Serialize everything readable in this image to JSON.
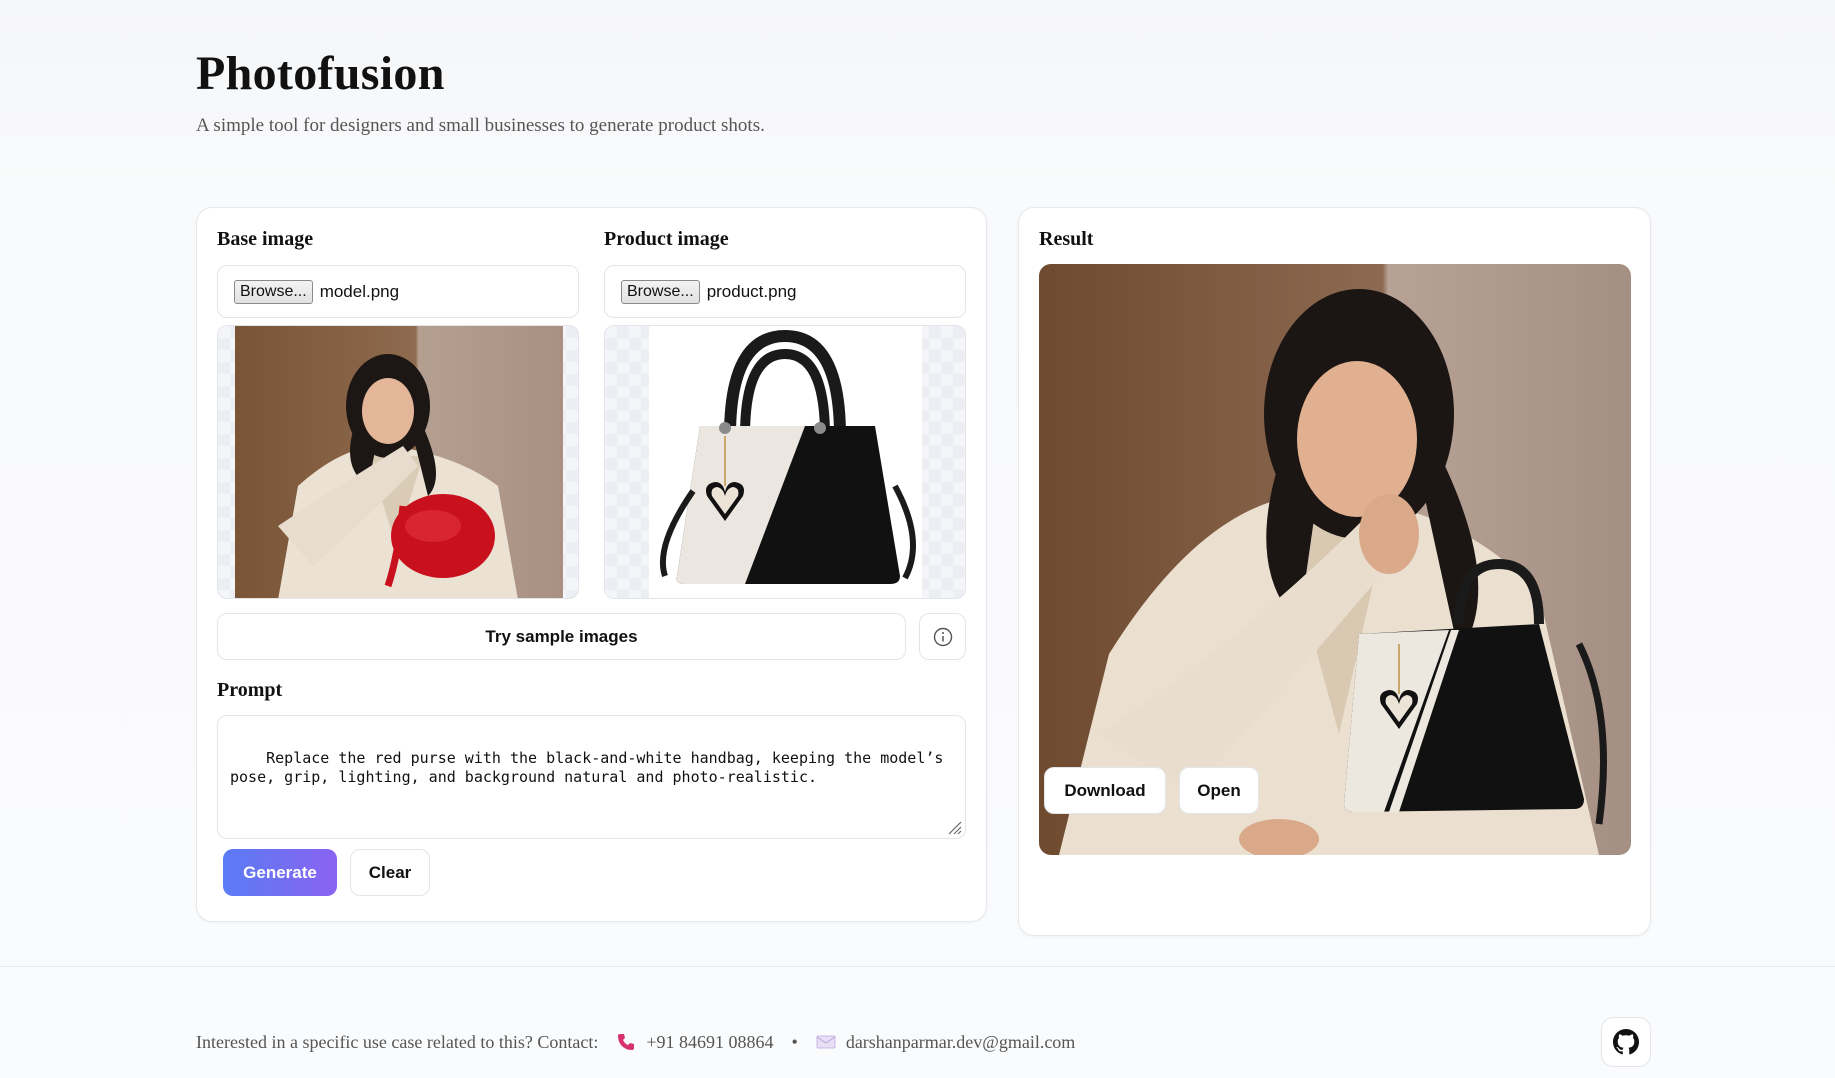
{
  "header": {
    "title": "Photofusion",
    "subtitle": "A simple tool for designers and small businesses to generate product shots."
  },
  "inputs": {
    "base": {
      "label": "Base image",
      "browse_label": "Browse...",
      "file_name": "model.png"
    },
    "product": {
      "label": "Product image",
      "browse_label": "Browse...",
      "file_name": "product.png"
    }
  },
  "sample_button": "Try sample images",
  "prompt": {
    "label": "Prompt",
    "value": "Replace the red purse with the black-and-white handbag, keeping the model’s pose, grip, lighting, and background natural and photo-realistic."
  },
  "actions": {
    "generate": "Generate",
    "clear": "Clear"
  },
  "result": {
    "label": "Result",
    "download": "Download",
    "open": "Open"
  },
  "footer": {
    "text": "Interested in a specific use case related to this? Contact:",
    "phone": "+91 84691 08864",
    "separator": "•",
    "email": "darshanparmar.dev@gmail.com"
  },
  "colors": {
    "accent_start": "#5a7cf4",
    "accent_end": "#8a63f1",
    "phone_icon": "#d6336c"
  }
}
